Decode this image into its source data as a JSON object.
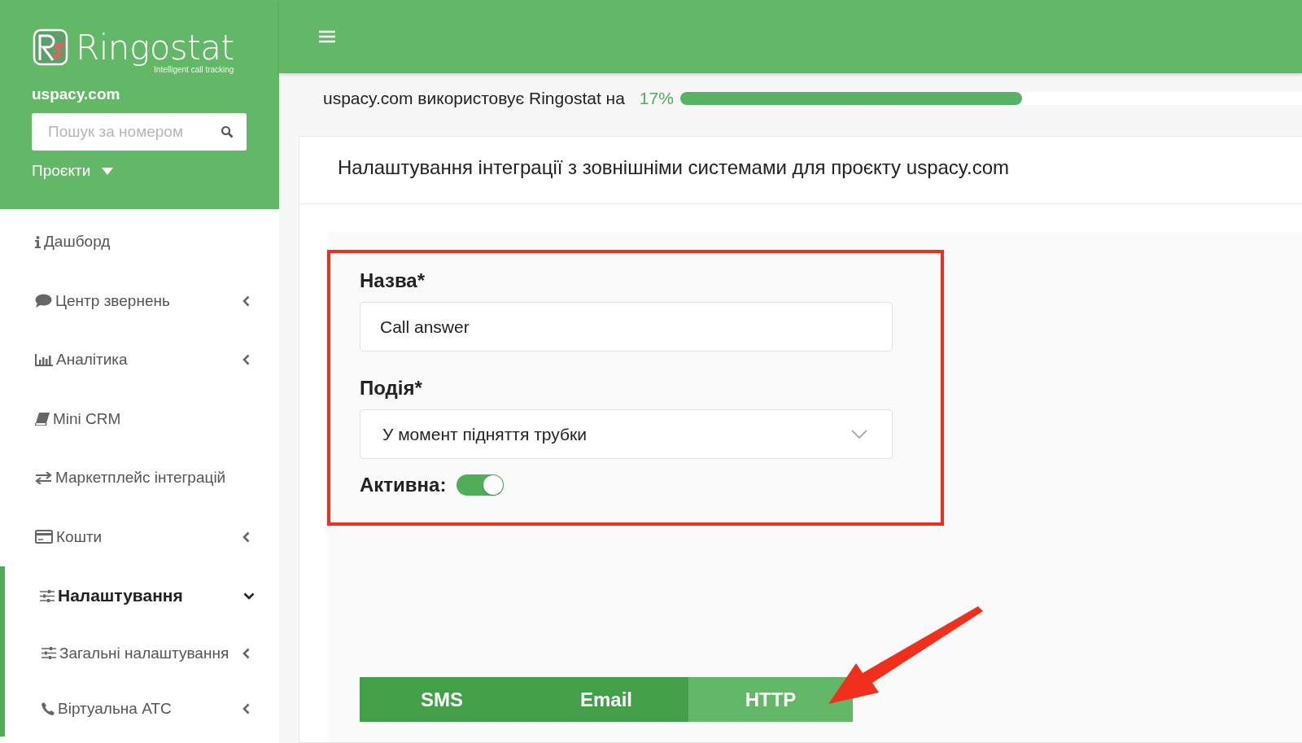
{
  "sidebar": {
    "logo": {
      "name": "Ringostat",
      "tagline": "Intelligent call tracking"
    },
    "project": "uspacy.com",
    "search": {
      "placeholder": "Пошук за номером"
    },
    "projects_menu": "Проєкти",
    "items": [
      {
        "label": "Дашборд",
        "kind": "link",
        "selected": false
      },
      {
        "label": "Центр звернень",
        "kind": "group",
        "expanded": false,
        "selected": false
      },
      {
        "label": "Аналітика",
        "kind": "group",
        "expanded": false,
        "selected": false
      },
      {
        "label": "Mini CRM",
        "kind": "link",
        "selected": false
      },
      {
        "label": "Маркетплейс інтеграцій",
        "kind": "link",
        "selected": false
      },
      {
        "label": "Кошти",
        "kind": "group",
        "expanded": false,
        "selected": false
      },
      {
        "label": "Налаштування",
        "kind": "group",
        "expanded": true,
        "selected": true
      },
      {
        "label": "Загальні налаштування",
        "kind": "subgroup",
        "expanded": false,
        "selected": false
      },
      {
        "label": "Віртуальна АТС",
        "kind": "subgroup",
        "expanded": false,
        "selected": false
      }
    ]
  },
  "usage": {
    "text": "uspacy.com використовує Ringostat на",
    "percent": "17%",
    "level": 0.55
  },
  "card": {
    "title": "Налаштування інтеграції з зовнішніми системами для проєкту uspacy.com",
    "form": {
      "name_label": "Назва*",
      "name_value": "Call answer",
      "event_label": "Подія*",
      "event_value": "У момент підняття трубки",
      "active_label": "Активна:",
      "active": true
    },
    "tabs": [
      {
        "label": "SMS",
        "selected": false
      },
      {
        "label": "Email",
        "selected": false
      },
      {
        "label": "HTTP",
        "selected": true
      }
    ]
  }
}
